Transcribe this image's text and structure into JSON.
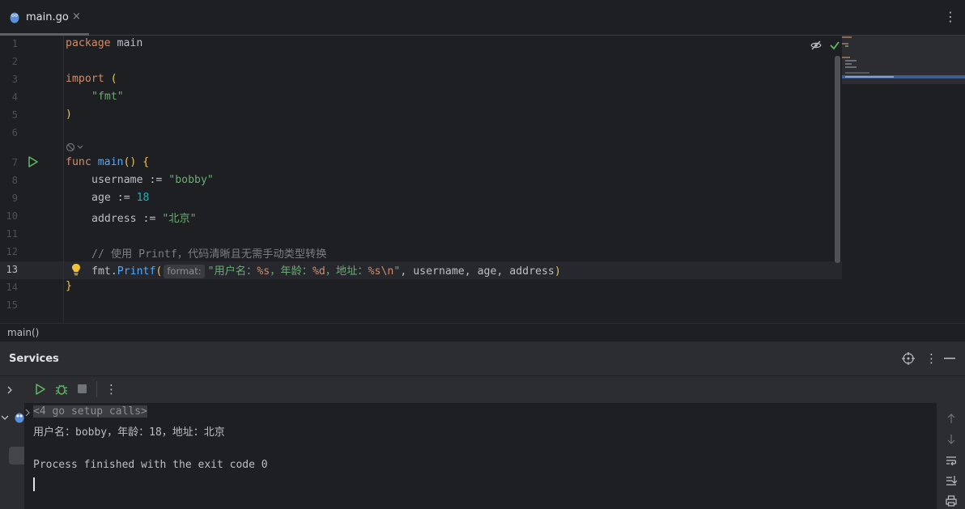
{
  "tab": {
    "filename": "main.go",
    "close": "×",
    "more": "⋮"
  },
  "editor": {
    "line_numbers": [
      "1",
      "2",
      "3",
      "4",
      "5",
      "6",
      "7",
      "8",
      "9",
      "10",
      "11",
      "12",
      "13",
      "14",
      "15"
    ],
    "current_line": 13,
    "code": {
      "l1_kw": "package",
      "l1_rest": " main",
      "l3_kw": "import",
      "l3_rest": " (",
      "l4_str": "\"fmt\"",
      "l5": ")",
      "l7_kw": "func",
      "l7_fn": "main",
      "l7_rest": "() {",
      "l8_a": "username := ",
      "l8_str": "\"bobby\"",
      "l9_a": "age := ",
      "l9_num": "18",
      "l10_a": "address := ",
      "l10_str": "\"北京\"",
      "l12_cmt": "// 使用 Printf，代码清晰且无需手动类型转换",
      "l13_a": "fmt.",
      "l13_fn": "Printf",
      "l13_open": "(",
      "l13_hint": "format:",
      "l13_s1": "\"用户名：",
      "l13_e1": "%s",
      "l13_s2": "，年龄：",
      "l13_e2": "%d",
      "l13_s3": "，地址：",
      "l13_e3": "%s\\n",
      "l13_s4": "\"",
      "l13_args": ", username, age, address",
      "l13_close": ")",
      "l14": "}"
    }
  },
  "breadcrumb": "main()",
  "services": {
    "title": "Services",
    "console_lines": {
      "setup": "<4 go setup calls>",
      "output": "用户名：bobby，年龄：18，地址：北京",
      "exit": "Process finished with the exit code 0"
    }
  },
  "colors": {
    "keyword": "#cf8e6d",
    "function": "#56a8f5",
    "string": "#6aab73",
    "number": "#2aacb8",
    "comment": "#7a7e85",
    "run_green": "#5fb865"
  },
  "icons": [
    "gopher-icon",
    "close-icon",
    "more-icon",
    "run-icon",
    "bulb-icon",
    "eye-slash-icon",
    "check-icon",
    "target-icon",
    "minimize-icon",
    "rerun-icon",
    "debug-icon",
    "stop-icon",
    "chevron-right-icon",
    "chevron-down-icon",
    "scroll-up-icon",
    "scroll-down-icon",
    "soft-wrap-icon",
    "scroll-end-icon",
    "print-icon"
  ]
}
